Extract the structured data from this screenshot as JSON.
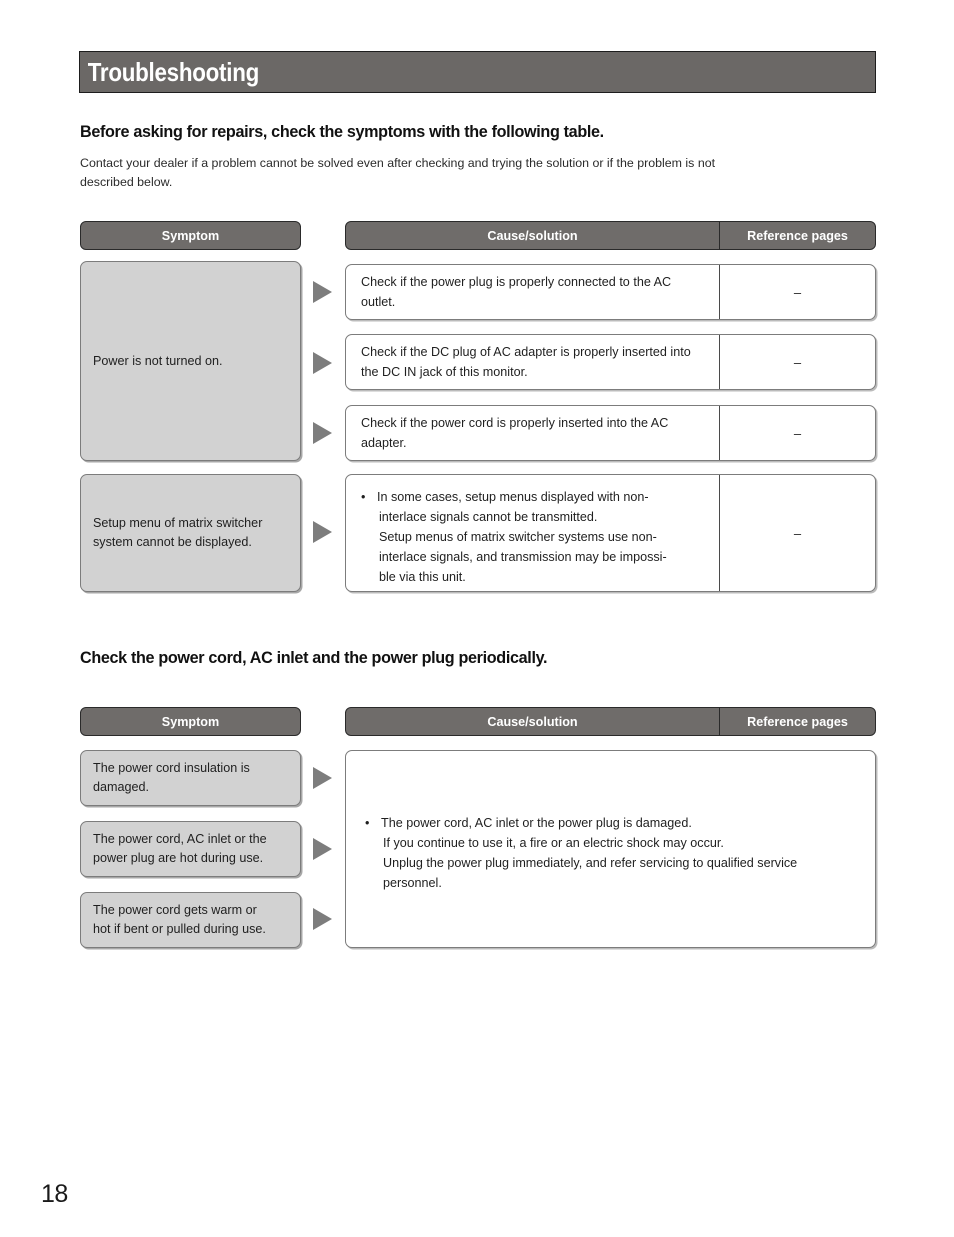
{
  "document": {
    "title": "Troubleshooting",
    "page_number": "18"
  },
  "sections": [
    {
      "heading": "Before asking for repairs, check the symptoms with the following table.",
      "intro_line1": "Contact your dealer if a problem cannot be solved even after checking and trying the solution or if the problem is not",
      "intro_line2": "described below.",
      "table": {
        "headers": {
          "symptom": "Symptom",
          "cause": "Cause/solution",
          "reference": "Reference pages"
        },
        "symptoms": [
          {
            "text": "Power is not turned on."
          },
          {
            "text": "Setup menu of matrix switcher system cannot be displayed."
          }
        ],
        "rows": [
          {
            "cause": "Check if the power plug is properly connected to the AC outlet.",
            "reference": "–"
          },
          {
            "cause": "Check if the DC plug of AC adapter is properly inserted into the DC IN jack of this monitor.",
            "reference": "–"
          },
          {
            "cause": "Check if the power cord is properly inserted into the AC adapter.",
            "reference": "–"
          },
          {
            "bullet": "•",
            "cause_line1": "In some cases, setup menus displayed with non-",
            "cause_line2": "interlace signals cannot be transmitted.",
            "cause_line3": "Setup menus of matrix switcher systems use non-",
            "cause_line4": "interlace signals, and transmission may be impossi-",
            "cause_line5": "ble via this unit.",
            "reference": "–"
          }
        ]
      }
    },
    {
      "heading": "Check the power cord, AC inlet and the power plug periodically.",
      "table": {
        "headers": {
          "symptom": "Symptom",
          "cause": "Cause/solution",
          "reference": "Reference pages"
        },
        "symptoms": [
          {
            "line1": "The power cord insulation is",
            "line2": "damaged."
          },
          {
            "line1": "The power cord, AC inlet or the",
            "line2": "power plug are hot during use."
          },
          {
            "line1": "The power cord gets warm or",
            "line2": "hot if bent or pulled during use."
          }
        ],
        "solution": {
          "bullet": "•",
          "line1": "The power cord, AC inlet or the power plug is damaged.",
          "line2": "If you continue to use it, a fire or an electric shock may occur.",
          "line3": "Unplug the power plug immediately, and refer servicing to qualified service",
          "line4": "personnel."
        }
      }
    }
  ],
  "colors": {
    "header_bar": "#6b6866",
    "table_header": "#6f6c6a",
    "symptom_fill": "#d2d2d2",
    "arrow": "#7d7d7d"
  }
}
